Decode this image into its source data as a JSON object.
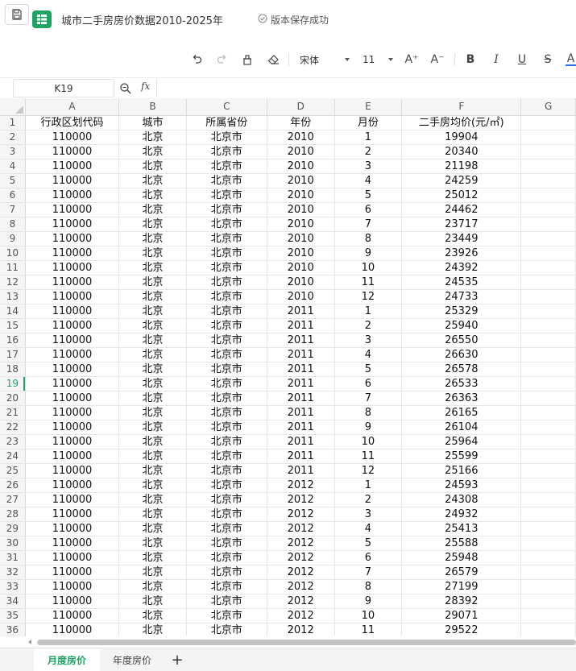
{
  "window": {
    "title": "城市二手房房价数据2010-2025年",
    "save_status": "版本保存成功",
    "accent_color": "#1fa463"
  },
  "toolbar": {
    "icons": [
      "undo-icon",
      "redo-icon",
      "format-painter-icon",
      "eraser-icon",
      "increase-font-icon",
      "decrease-font-icon",
      "bold-icon",
      "italic-icon",
      "underline-icon",
      "strikethrough-icon",
      "font-color-icon"
    ],
    "font_name": "宋体",
    "font_size": "11",
    "increase_font_label": "A⁺",
    "decrease_font_label": "A⁻",
    "bold_label": "B",
    "italic_label": "I",
    "underline_label": "U",
    "strike_label": "S",
    "font_color_label": "A"
  },
  "formula_bar": {
    "cell_ref": "K19",
    "fx_label": "fx",
    "value": ""
  },
  "grid": {
    "columns": [
      "A",
      "B",
      "C",
      "D",
      "E",
      "F",
      "G"
    ],
    "active_row": 19,
    "header_row": [
      "行政区划代码",
      "城市",
      "所属省份",
      "年份",
      "月份",
      "二手房均价(元/㎡)"
    ],
    "rows": [
      [
        "110000",
        "北京",
        "北京市",
        "2010",
        "1",
        "19904"
      ],
      [
        "110000",
        "北京",
        "北京市",
        "2010",
        "2",
        "20340"
      ],
      [
        "110000",
        "北京",
        "北京市",
        "2010",
        "3",
        "21198"
      ],
      [
        "110000",
        "北京",
        "北京市",
        "2010",
        "4",
        "24259"
      ],
      [
        "110000",
        "北京",
        "北京市",
        "2010",
        "5",
        "25012"
      ],
      [
        "110000",
        "北京",
        "北京市",
        "2010",
        "6",
        "24462"
      ],
      [
        "110000",
        "北京",
        "北京市",
        "2010",
        "7",
        "23717"
      ],
      [
        "110000",
        "北京",
        "北京市",
        "2010",
        "8",
        "23449"
      ],
      [
        "110000",
        "北京",
        "北京市",
        "2010",
        "9",
        "23926"
      ],
      [
        "110000",
        "北京",
        "北京市",
        "2010",
        "10",
        "24392"
      ],
      [
        "110000",
        "北京",
        "北京市",
        "2010",
        "11",
        "24535"
      ],
      [
        "110000",
        "北京",
        "北京市",
        "2010",
        "12",
        "24733"
      ],
      [
        "110000",
        "北京",
        "北京市",
        "2011",
        "1",
        "25329"
      ],
      [
        "110000",
        "北京",
        "北京市",
        "2011",
        "2",
        "25940"
      ],
      [
        "110000",
        "北京",
        "北京市",
        "2011",
        "3",
        "26550"
      ],
      [
        "110000",
        "北京",
        "北京市",
        "2011",
        "4",
        "26630"
      ],
      [
        "110000",
        "北京",
        "北京市",
        "2011",
        "5",
        "26578"
      ],
      [
        "110000",
        "北京",
        "北京市",
        "2011",
        "6",
        "26533"
      ],
      [
        "110000",
        "北京",
        "北京市",
        "2011",
        "7",
        "26363"
      ],
      [
        "110000",
        "北京",
        "北京市",
        "2011",
        "8",
        "26165"
      ],
      [
        "110000",
        "北京",
        "北京市",
        "2011",
        "9",
        "26104"
      ],
      [
        "110000",
        "北京",
        "北京市",
        "2011",
        "10",
        "25964"
      ],
      [
        "110000",
        "北京",
        "北京市",
        "2011",
        "11",
        "25599"
      ],
      [
        "110000",
        "北京",
        "北京市",
        "2011",
        "12",
        "25166"
      ],
      [
        "110000",
        "北京",
        "北京市",
        "2012",
        "1",
        "24593"
      ],
      [
        "110000",
        "北京",
        "北京市",
        "2012",
        "2",
        "24308"
      ],
      [
        "110000",
        "北京",
        "北京市",
        "2012",
        "3",
        "24932"
      ],
      [
        "110000",
        "北京",
        "北京市",
        "2012",
        "4",
        "25413"
      ],
      [
        "110000",
        "北京",
        "北京市",
        "2012",
        "5",
        "25588"
      ],
      [
        "110000",
        "北京",
        "北京市",
        "2012",
        "6",
        "25948"
      ],
      [
        "110000",
        "北京",
        "北京市",
        "2012",
        "7",
        "26579"
      ],
      [
        "110000",
        "北京",
        "北京市",
        "2012",
        "8",
        "27199"
      ],
      [
        "110000",
        "北京",
        "北京市",
        "2012",
        "9",
        "28392"
      ],
      [
        "110000",
        "北京",
        "北京市",
        "2012",
        "10",
        "29071"
      ],
      [
        "110000",
        "北京",
        "北京市",
        "2012",
        "11",
        "29522"
      ]
    ]
  },
  "sheets": {
    "tabs": [
      "月度房价",
      "年度房价"
    ],
    "active": "月度房价",
    "add_label": "+"
  }
}
